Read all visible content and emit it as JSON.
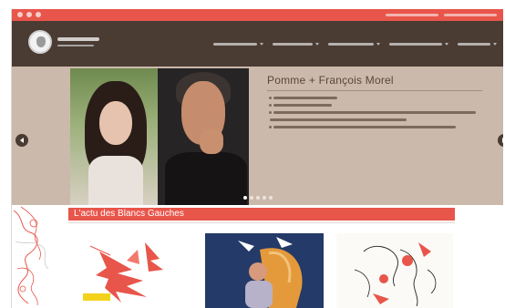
{
  "top_bar": {
    "social_icons": [
      "social-icon-1",
      "social-icon-2",
      "social-icon-3"
    ],
    "links": [
      "",
      ""
    ]
  },
  "header": {
    "logo_icon": "site-logo",
    "nav_items": [
      {
        "label": ""
      },
      {
        "label": ""
      },
      {
        "label": ""
      },
      {
        "label": ""
      },
      {
        "label": ""
      }
    ]
  },
  "hero": {
    "title": "Pomme + François Morel",
    "lines": [
      "",
      "",
      "",
      "",
      ""
    ],
    "arrows": {
      "prev_icon": "chevron-left-icon",
      "next_icon": "chevron-right-icon"
    },
    "dots_count": 5,
    "active_dot": 0
  },
  "news": {
    "title": "L'actu des Blancs Gauches"
  },
  "colors": {
    "accent": "#e8554a",
    "header_bg": "#4a3b33",
    "hero_bg": "#cbb9ac"
  }
}
